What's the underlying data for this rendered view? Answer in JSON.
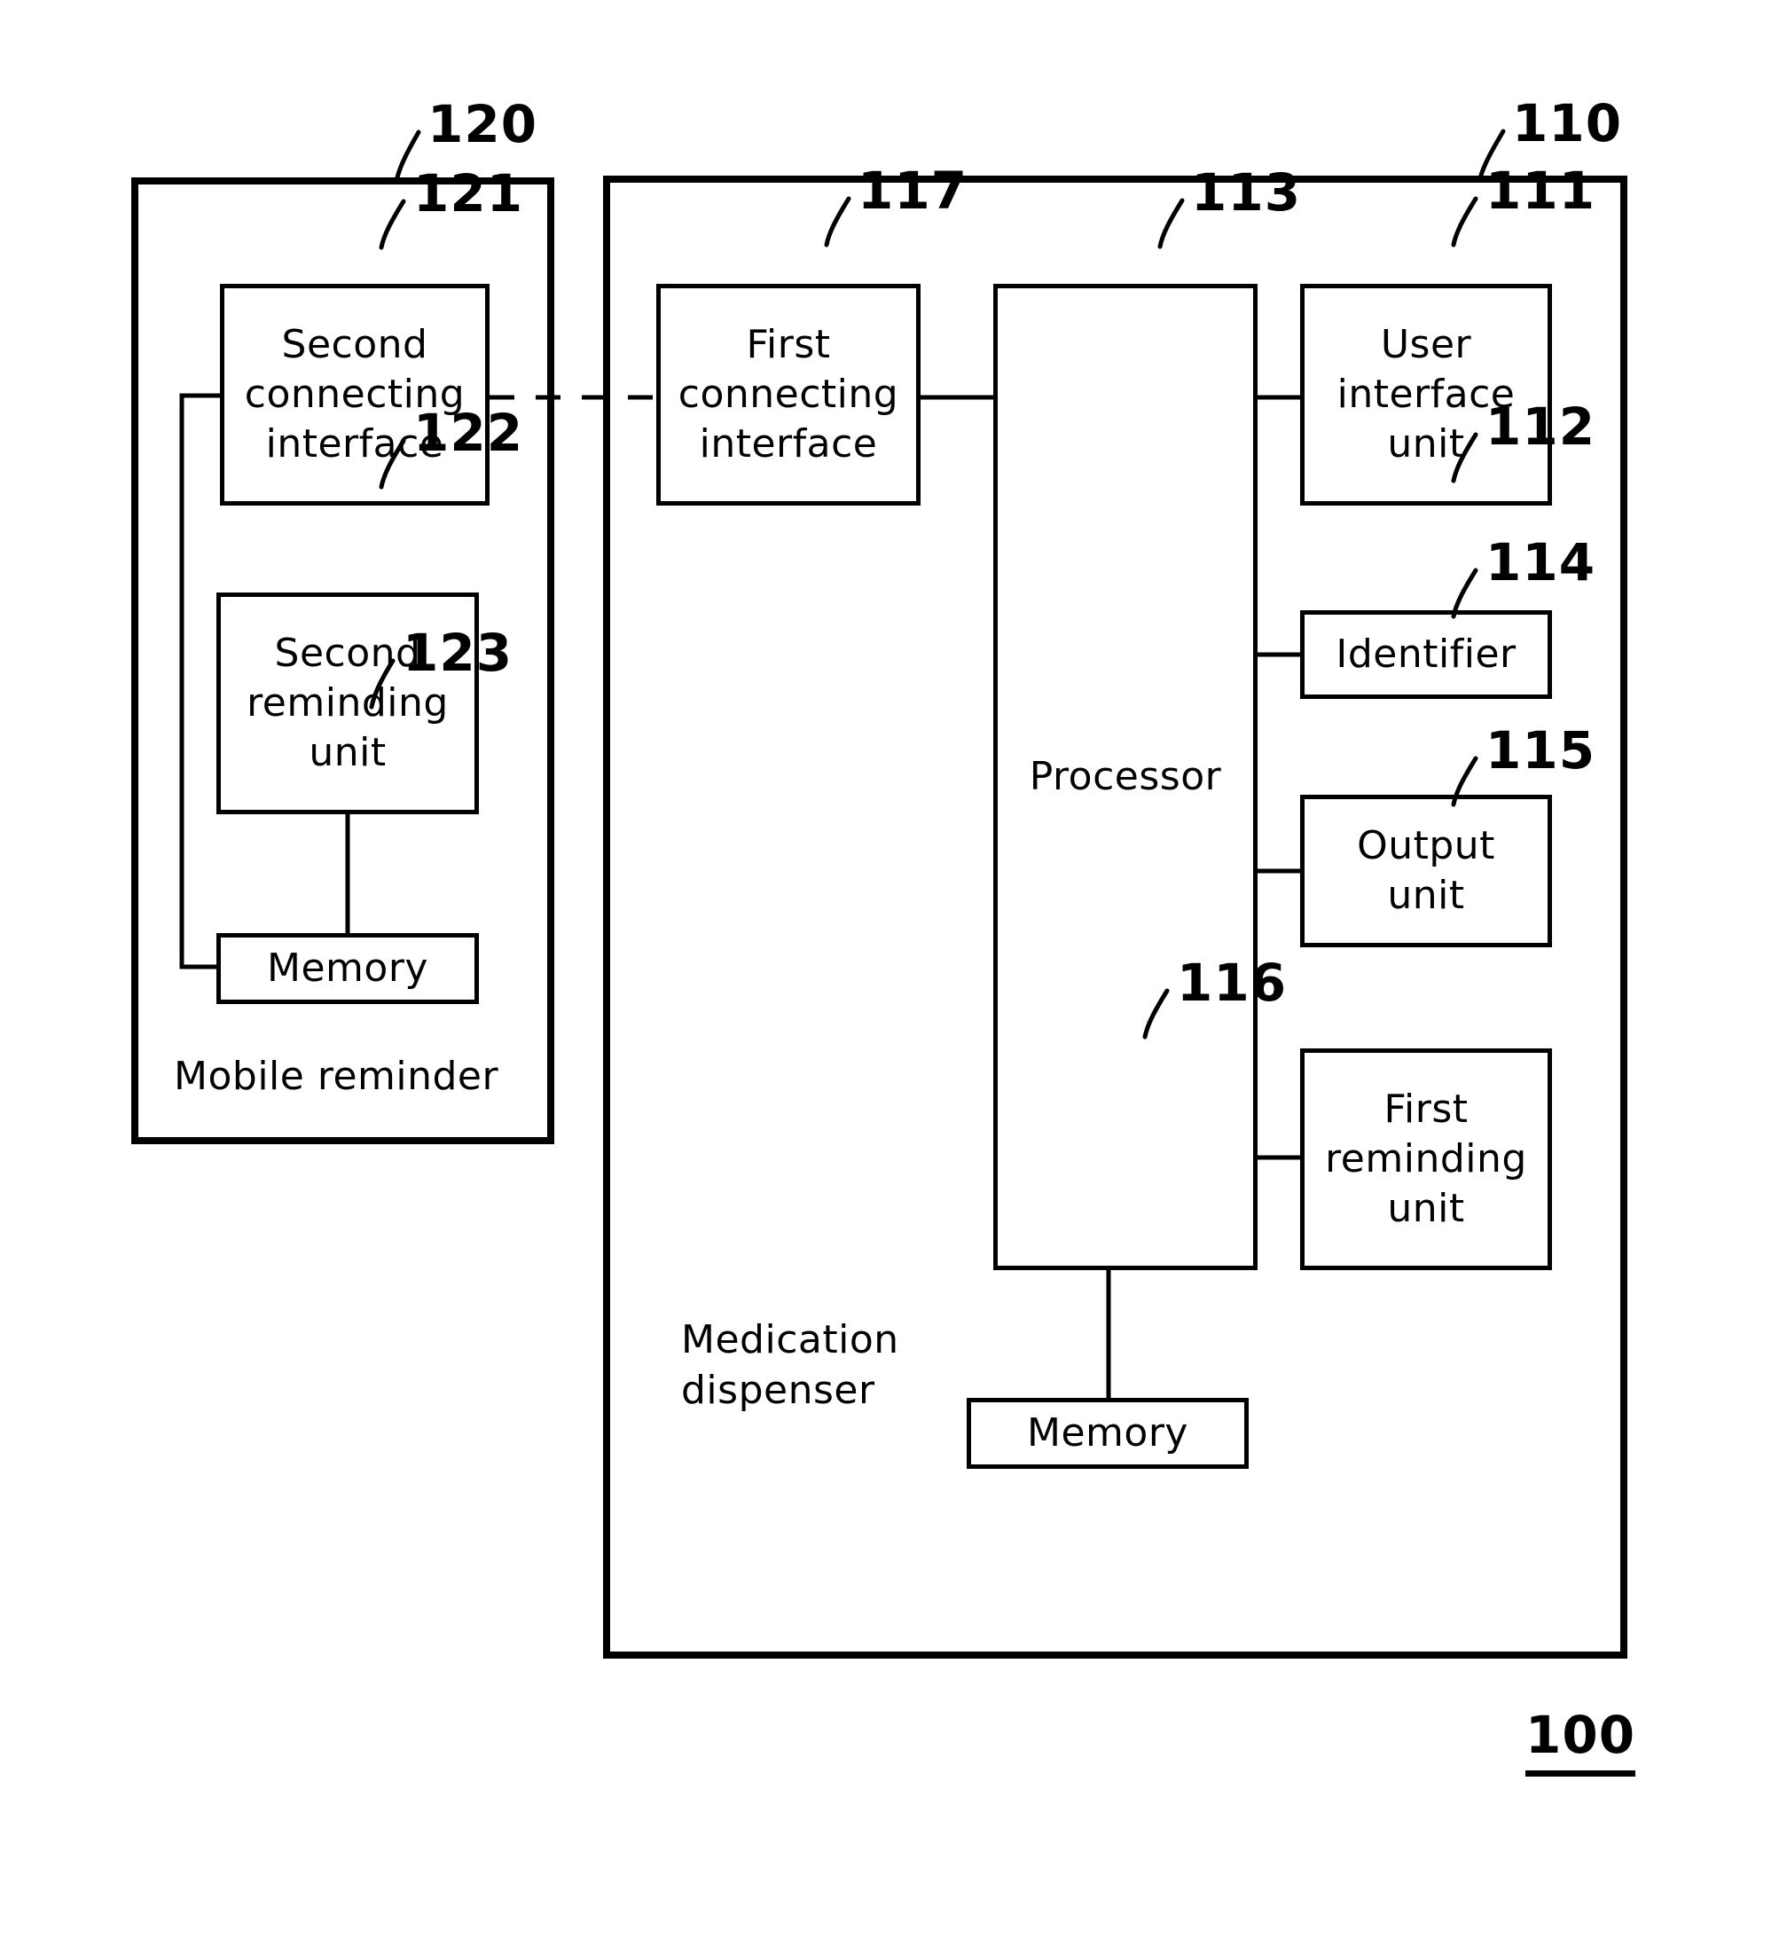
{
  "figure": {
    "id_label": "100",
    "title_hidden": ""
  },
  "containers": [
    {
      "key": "mobile_reminder",
      "ref": "120",
      "caption": "Mobile  reminder"
    },
    {
      "key": "medication_dispenser",
      "ref": "110",
      "caption": "Medication\ndispenser"
    }
  ],
  "blocks": {
    "second_connecting_interface": {
      "label": "Second\nconnecting\ninterface",
      "ref": "121"
    },
    "second_reminding_unit": {
      "label": "Second\nreminding\nunit",
      "ref": "122"
    },
    "second_memory": {
      "label": "Memory",
      "ref": "123"
    },
    "first_connecting_interface": {
      "label": "First\nconnecting\ninterface",
      "ref": "117"
    },
    "processor": {
      "label": "Processor",
      "ref": "113"
    },
    "user_interface_unit": {
      "label": "User\ninterface\nunit",
      "ref": "111"
    },
    "identifier": {
      "label": "Identifier",
      "ref": "112"
    },
    "output_unit": {
      "label": "Output\nunit",
      "ref": "114"
    },
    "first_reminding_unit": {
      "label": "First\nreminding\nunit",
      "ref": "115"
    },
    "first_memory": {
      "label": "Memory",
      "ref": "116"
    }
  },
  "colors": {
    "stroke": "#000000",
    "background": "#ffffff"
  }
}
